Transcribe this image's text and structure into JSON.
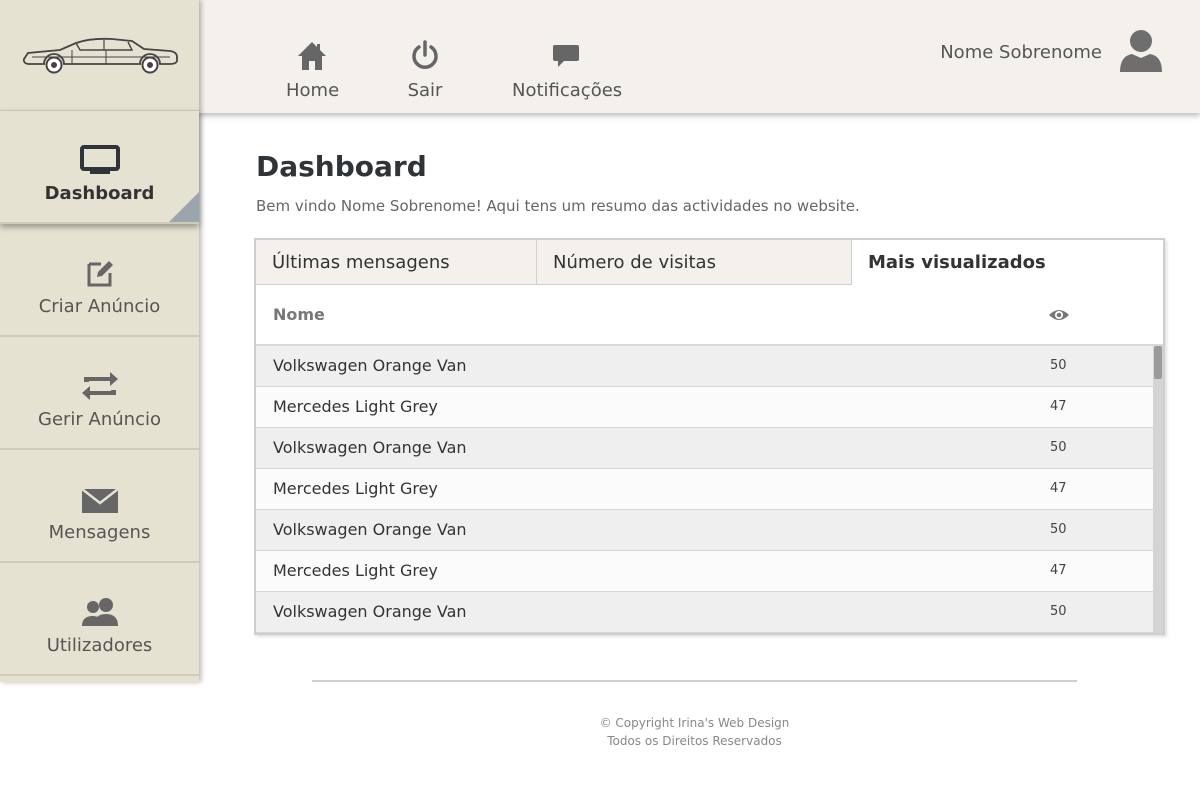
{
  "brand": {
    "logo_icon": "vintage-car-icon"
  },
  "topnav": {
    "items": [
      {
        "label": "Home",
        "icon": "home-icon"
      },
      {
        "label": "Sair",
        "icon": "power-icon"
      },
      {
        "label": "Notificações",
        "icon": "chat-bubble-icon"
      }
    ],
    "user_name": "Nome Sobrenome",
    "avatar_icon": "user-icon"
  },
  "sidebar": {
    "items": [
      {
        "label": "Dashboard",
        "icon": "monitor-icon",
        "active": true
      },
      {
        "label": "Criar Anúncio",
        "icon": "edit-icon"
      },
      {
        "label": "Gerir Anúncio",
        "icon": "swap-arrows-icon"
      },
      {
        "label": "Mensagens",
        "icon": "envelope-icon"
      },
      {
        "label": "Utilizadores",
        "icon": "users-icon"
      }
    ]
  },
  "main": {
    "title": "Dashboard",
    "subtitle": "Bem vindo Nome Sobrenome! Aqui tens um resumo das actividades no website."
  },
  "tabs": [
    {
      "label": "Últimas mensagens"
    },
    {
      "label": "Número de visitas"
    },
    {
      "label": "Mais visualizados",
      "active": true
    }
  ],
  "table": {
    "columns": {
      "name": "Nome",
      "views_icon": "eye-icon"
    },
    "rows": [
      {
        "name": "Volkswagen Orange Van",
        "views": "50"
      },
      {
        "name": "Mercedes Light Grey",
        "views": "47"
      },
      {
        "name": "Volkswagen Orange Van",
        "views": "50"
      },
      {
        "name": "Mercedes Light Grey",
        "views": "47"
      },
      {
        "name": "Volkswagen Orange Van",
        "views": "50"
      },
      {
        "name": "Mercedes Light Grey",
        "views": "47"
      },
      {
        "name": "Volkswagen Orange Van",
        "views": "50"
      }
    ]
  },
  "footer": {
    "copyright": "© Copyright Irina's Web Design",
    "rights": "Todos os Direitos Reservados"
  },
  "colors": {
    "sidebar_bg": "#e6e2d2",
    "topbar_bg": "#f4f1ec",
    "active_corner": "#9aa5ae"
  }
}
